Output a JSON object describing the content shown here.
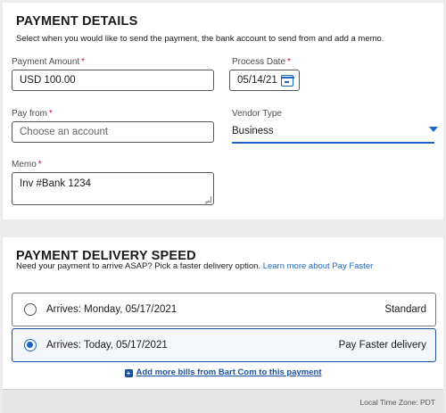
{
  "payment_details": {
    "title": "PAYMENT DETAILS",
    "description": "Select when you would like to send the payment, the bank account to send from and add a memo.",
    "amount": {
      "label": "Payment Amount",
      "required_mark": "*",
      "value": "USD 100.00"
    },
    "process_date": {
      "label": "Process Date",
      "required_mark": "*",
      "value": "05/14/21",
      "icon": "calendar-icon"
    },
    "pay_from": {
      "label": "Pay from",
      "required_mark": "*",
      "placeholder": "Choose an account"
    },
    "vendor_type": {
      "label": "Vendor Type",
      "value": "Business",
      "icon": "chevron-down-icon"
    },
    "memo": {
      "label": "Memo",
      "required_mark": "*",
      "value": "Inv #Bank 1234"
    }
  },
  "delivery_speed": {
    "title": "PAYMENT DELIVERY SPEED",
    "description": "Need your payment to arrive ASAP? Pick a faster delivery option.",
    "learn_more_link": "Learn more about Pay Faster",
    "options": [
      {
        "arrives": "Arrives: Monday, 05/17/2021",
        "type": "Standard",
        "selected": false
      },
      {
        "arrives": "Arrives: Today, 05/17/2021",
        "type": "Pay Faster delivery",
        "selected": true
      }
    ],
    "add_bills_link": "Add more bills from Bart Com to this payment",
    "add_icon": "plus-square-icon"
  },
  "footer": {
    "timezone": "Local Time Zone: PDT"
  },
  "colors": {
    "accent": "#1a66c8",
    "required": "#c8102e",
    "background": "#ececec"
  }
}
